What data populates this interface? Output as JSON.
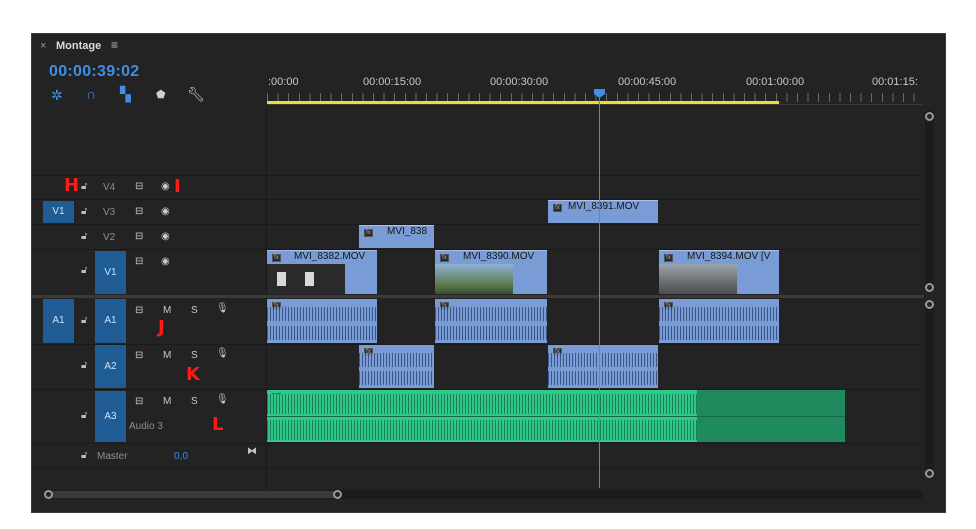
{
  "panel": {
    "close_glyph": "×",
    "title": "Montage",
    "menu_glyph": "≡"
  },
  "timecode": "00:00:39:02",
  "tools": [
    "snap-icon",
    "magnet-icon",
    "linked-selection-icon",
    "marker-icon",
    "wrench-icon"
  ],
  "ruler": {
    "labels": [
      ":00:00",
      "00:00:15:00",
      "00:00:30:00",
      "00:00:45:00",
      "00:01:00:00",
      "00:01:15:"
    ]
  },
  "tracks": {
    "v4": "V4",
    "v3": "V3",
    "v2": "V2",
    "v1": "V1",
    "v1_src": "V1",
    "a1": "A1",
    "a2": "A2",
    "a3": "A3",
    "a1_src": "A1",
    "audio3_name": "Audio 3",
    "master_label": "Master",
    "master_value": "0,0",
    "m": "M",
    "s": "S"
  },
  "clips": {
    "v3": "MVI_8391.MOV",
    "v2": "MVI_838",
    "v1a": "MVI_8382.MOV",
    "v1b": "MVI_8390.MOV",
    "v1c": "MVI_8394.MOV [V"
  },
  "annotations": {
    "h": "H",
    "i": "I",
    "j": "J",
    "k": "K",
    "l": "L"
  },
  "colors": {
    "accent": "#3f8fe6",
    "video_clip": "#7a9cd6",
    "audio3_clip": "#2ec88a",
    "work_area": "#e8e02a"
  }
}
